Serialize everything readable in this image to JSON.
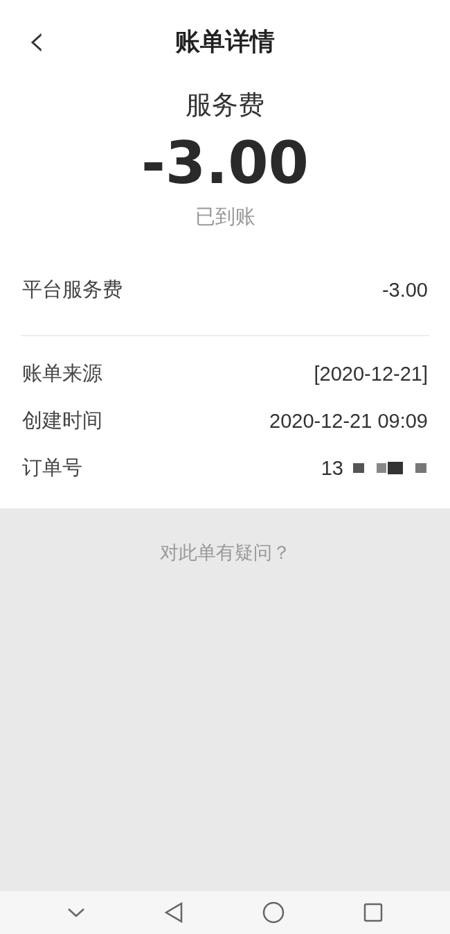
{
  "header": {
    "back": "‹",
    "title": "账单详情"
  },
  "summary": {
    "type": "服务费",
    "amount": "-3.00",
    "status": "已到账"
  },
  "fee_row": {
    "label": "平台服务费",
    "value": "-3.00"
  },
  "details": [
    {
      "label": "账单来源",
      "value": "[2020-12-21]",
      "kind": "text"
    },
    {
      "label": "创建时间",
      "value": "2020-12-21 09:09",
      "kind": "text"
    },
    {
      "label": "订单号",
      "value": "13",
      "kind": "redacted"
    }
  ],
  "help_link": "对此单有疑问？"
}
